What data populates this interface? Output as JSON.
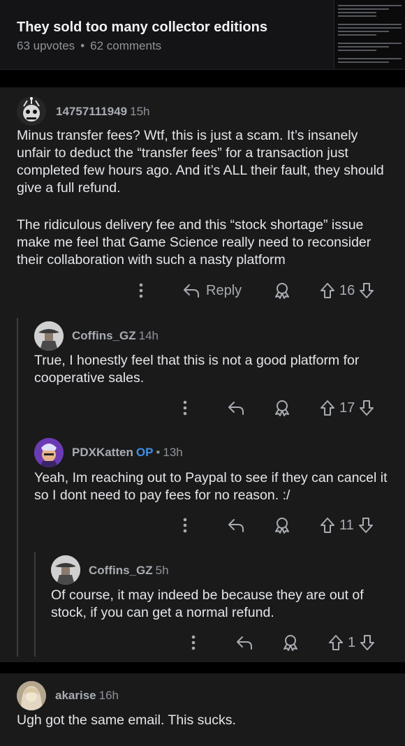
{
  "post": {
    "title": "They sold too many collector editions",
    "upvotes": "63 upvotes",
    "separator": "•",
    "comments": "62 comments"
  },
  "comments": [
    {
      "username": "14757111949",
      "age": "15h",
      "body": "Minus transfer fees? Wtf, this is just a scam. It’s insanely unfair to deduct the “transfer fees” for a transaction just completed few hours ago. And it’s ALL their fault, they should give a full refund.",
      "body2": "The ridiculous delivery fee and this “stock shortage” issue make me feel that Game Science really need to reconsider their collaboration with such a nasty platform",
      "reply_label": "Reply",
      "score": "16"
    },
    {
      "username": "Coffins_GZ",
      "age": "14h",
      "body": "True, I honestly feel that this is not a good platform for cooperative sales.",
      "score": "17"
    },
    {
      "username": "PDXKatten",
      "op_label": "OP",
      "dot": "•",
      "age": "13h",
      "body": "Yeah, Im reaching out to Paypal to see if they can cancel it so I dont need to pay fees for no reason. :/",
      "score": "11"
    },
    {
      "username": "Coffins_GZ",
      "age": "5h",
      "body": "Of course, it may indeed be because they are out of stock, if you can get a normal refund.",
      "score": "1"
    },
    {
      "username": "akarise",
      "age": "16h",
      "body": "Ugh got the same email. This sucks."
    }
  ],
  "icons": [
    "more-icon",
    "reply-icon",
    "award-icon",
    "upvote-icon",
    "downvote-icon"
  ],
  "colors": {
    "background": "#1a1a1b",
    "op_accent": "#3f8fe8",
    "text": "#e4e6e9",
    "muted": "#a8acb2"
  }
}
